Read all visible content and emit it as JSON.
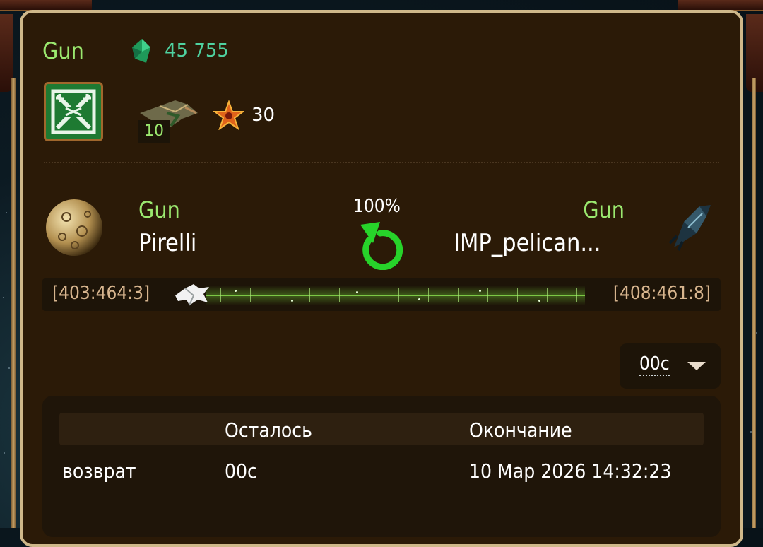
{
  "header": {
    "owner": "Gun",
    "gem_count": "45 755",
    "ship_count": "10",
    "rank_value": "30"
  },
  "fleet": {
    "percent": "100%",
    "origin": {
      "owner": "Gun",
      "name": "Pirelli",
      "coords": "[403:464:3]"
    },
    "target": {
      "owner": "Gun",
      "name": "IMP_pelican...",
      "coords": "[408:461:8]"
    }
  },
  "timer": {
    "value": "00с"
  },
  "table": {
    "headers": [
      "",
      "Осталось",
      "Окончание"
    ],
    "rows": [
      {
        "mission": "возврат",
        "remaining": "00с",
        "end": "10 Мар 2026 14:32:23"
      }
    ]
  },
  "colors": {
    "panel_bg": "#2b1a07",
    "panel_border": "#cfb88a",
    "owner_green": "#9be86f",
    "gem_teal": "#4fd2a0",
    "coord_tan": "#d7b58e",
    "return_green": "#27d32a"
  },
  "icons": [
    "gem-icon",
    "alliance-emblem-icon",
    "ship-icon",
    "rank-star-icon",
    "planet-icon",
    "return-arrow-icon",
    "fleet-ship-icon",
    "route-fleet-icon",
    "chevron-down-icon"
  ]
}
